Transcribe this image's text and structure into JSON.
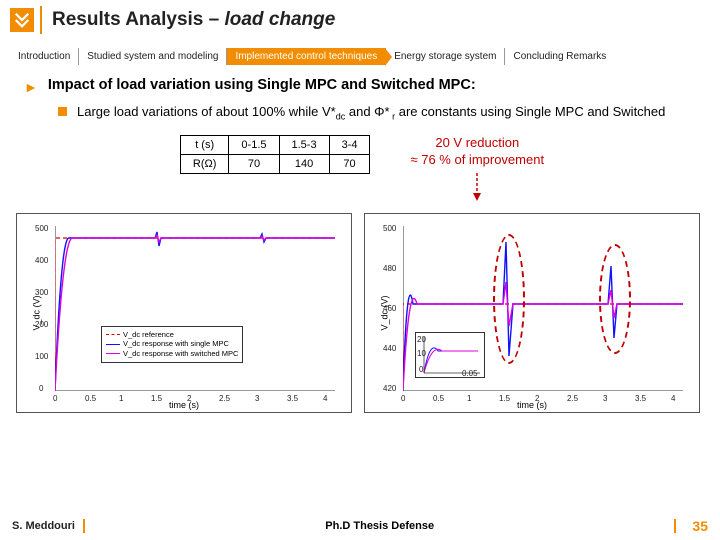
{
  "header": {
    "title_main": "Results Analysis – ",
    "title_italic": "load change"
  },
  "tabs": [
    {
      "label": "Introduction",
      "active": false
    },
    {
      "label": "Studied system and modeling",
      "active": false
    },
    {
      "label": "Implemented control techniques",
      "active": true
    },
    {
      "label": "Energy storage system",
      "active": false
    },
    {
      "label": "Concluding Remarks",
      "active": false
    }
  ],
  "heading": "Impact of load variation using Single MPC and Switched MPC:",
  "body_pre": "Large load variations of about 100%  while V*",
  "body_sub1": "dc",
  "body_mid": " and Φ*",
  "body_sub2": " r",
  "body_post": " are constants using Single MPC and Switched",
  "table": {
    "row1": [
      "t (s)",
      "0-1.5",
      "1.5-3",
      "3-4"
    ],
    "row2": [
      "R(Ω)",
      "70",
      "140",
      "70"
    ]
  },
  "annotation": {
    "line1": "20 V reduction",
    "line2": "≈ 76 % of   improvement"
  },
  "chart_data": [
    {
      "type": "line",
      "xlabel": "time (s)",
      "ylabel": "V_dc (V)",
      "xlim": [
        0,
        4
      ],
      "ylim": [
        0,
        500
      ],
      "xticks": [
        0,
        0.5,
        1,
        1.5,
        2,
        2.5,
        3,
        3.5,
        4
      ],
      "yticks": [
        0,
        100,
        200,
        300,
        400,
        500
      ],
      "series": [
        {
          "name": "V_dc reference",
          "color": "#d00",
          "style": "dashed",
          "y_steady": 465
        },
        {
          "name": "V_dc response with single MPC",
          "color": "#11f",
          "style": "solid",
          "y_steady": 465
        },
        {
          "name": "V_dc response with switched MPC",
          "color": "#d0d",
          "style": "solid",
          "y_steady": 465
        }
      ]
    },
    {
      "type": "line",
      "xlabel": "time (s)",
      "ylabel": "V_dc (V)",
      "xlim": [
        0,
        4
      ],
      "ylim": [
        420,
        500
      ],
      "xticks": [
        0,
        0.5,
        1,
        1.5,
        2,
        2.5,
        3,
        3.5,
        4
      ],
      "yticks": [
        420,
        440,
        460,
        480,
        500
      ],
      "inset": {
        "xticks": [
          0,
          0.05
        ],
        "yticks": [
          0,
          10,
          20
        ]
      },
      "series": [
        {
          "name": "reference",
          "color": "#d00",
          "style": "dashed"
        },
        {
          "name": "single MPC",
          "color": "#11f",
          "style": "solid"
        },
        {
          "name": "switched MPC",
          "color": "#d0d",
          "style": "solid"
        }
      ]
    }
  ],
  "legend": {
    "items": [
      {
        "label": "V_dc reference",
        "color": "#d00",
        "dashed": true
      },
      {
        "label": "V_dc response with single MPC",
        "color": "#11f",
        "dashed": false
      },
      {
        "label": "V_dc response with switched MPC",
        "color": "#d0d",
        "dashed": false
      }
    ]
  },
  "footer": {
    "author": "S. Meddouri",
    "center": "Ph.D Thesis Defense",
    "page": "35"
  }
}
